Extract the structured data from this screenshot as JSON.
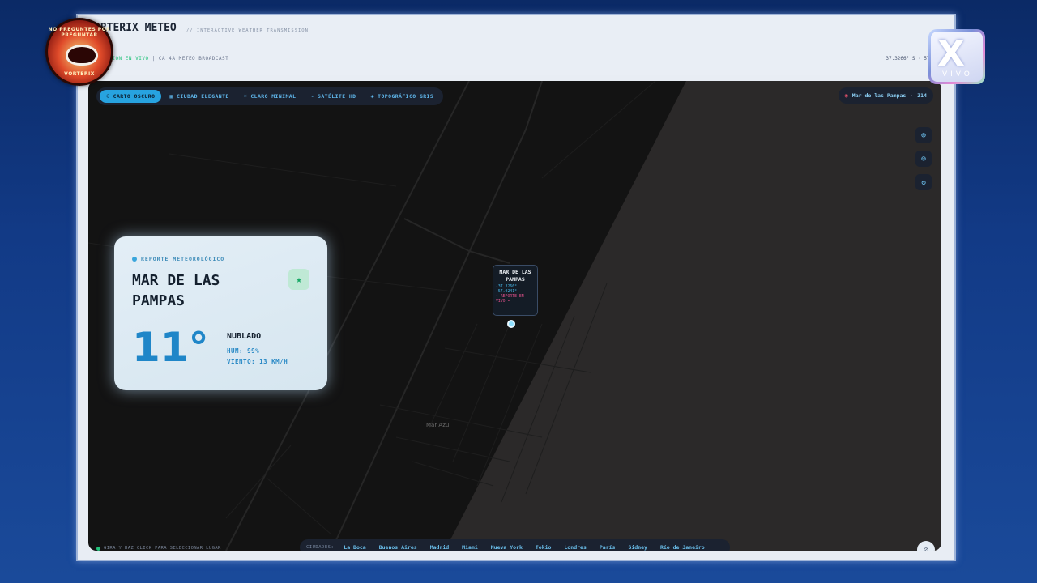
{
  "app": {
    "title": "ORTERIX METEO",
    "subtitle": "// INTERACTIVE WEATHER TRANSMISSION",
    "status_live": "MISIÓN EN VIVO",
    "status_rest": "| CA 4A METEO BROADCAST",
    "coords": "37.3266° S · 57.024"
  },
  "overlay": {
    "left_logo_top": "NO PREGUNTES POR PREGUNTAR",
    "left_logo_bottom": "VORTERIX",
    "right_logo_mark": "X",
    "right_logo_text": "VIVO"
  },
  "map_styles": [
    {
      "label": "CARTO OSCURO",
      "icon": "moon-icon",
      "active": true
    },
    {
      "label": "CIUDAD ELEGANTE",
      "icon": "building-icon",
      "active": false
    },
    {
      "label": "CLARO MINIMAL",
      "icon": "sun-icon",
      "active": false
    },
    {
      "label": "SATÉLITE HD",
      "icon": "satellite-icon",
      "active": false
    },
    {
      "label": "TOPOGRÁFICO GRIS",
      "icon": "layers-icon",
      "active": false
    }
  ],
  "location_chip": {
    "label": "Mar de las Pampas",
    "zoom": "Z14"
  },
  "zoom_controls": [
    "zoom-in-icon",
    "zoom-out-icon",
    "reset-icon"
  ],
  "report": {
    "label": "REPORTE METEOROLÓGICO",
    "city": "MAR DE LAS PAMPAS",
    "temperature": "11°",
    "condition": "NUBLADO",
    "humidity": "HUM: 99%",
    "wind": "VIENTO: 13 KM/H"
  },
  "marker": {
    "city": "MAR DE LAS PAMPAS",
    "coords": "-37.3266°, -57.0241°",
    "live": "• REPORTE EN VIVO •"
  },
  "place_label": "Mar Azul",
  "hint": "GIRA Y HAZ CLICK PARA SELECCIONAR LUGAR",
  "cities": {
    "label": "CIUDADES:",
    "items": [
      "La Boca",
      "Buenos Aires",
      "Madrid",
      "Miami",
      "Nueva York",
      "Tokio",
      "Londres",
      "París",
      "Sidney",
      "Río de Janeiro"
    ]
  },
  "colors": {
    "accent": "#27a3e0",
    "live": "#22c27a",
    "temp": "#1f86c8",
    "map_land": "#131313",
    "map_ocean": "#2b2929"
  }
}
